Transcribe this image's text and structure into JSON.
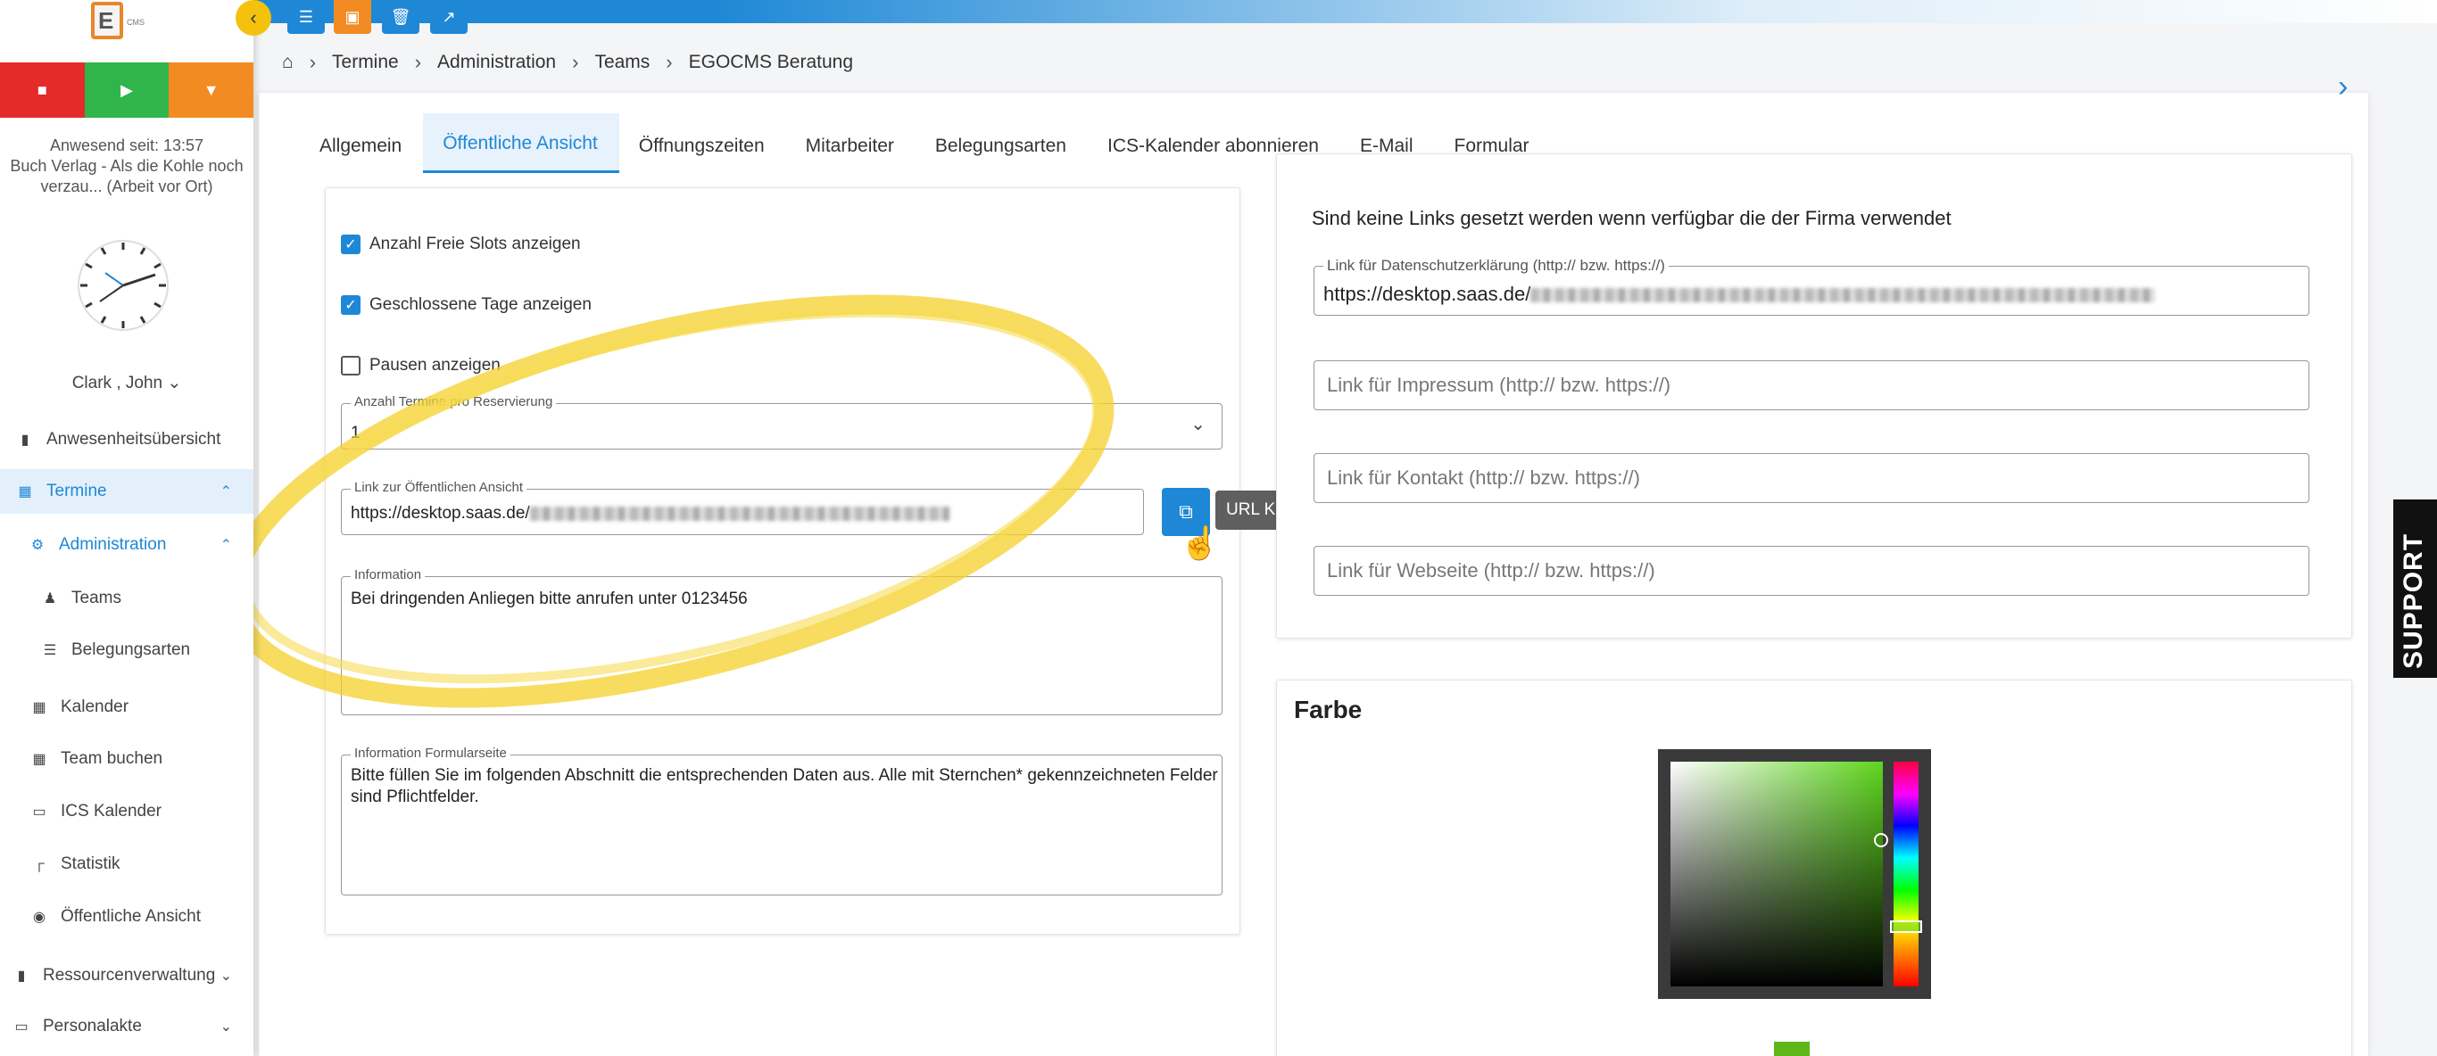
{
  "brand": {
    "logo_letter": "E",
    "logo_suffix": "CMS"
  },
  "toolbar": {
    "icons": [
      "list-icon",
      "save-icon",
      "trash-icon",
      "external-link-icon"
    ]
  },
  "sidebar": {
    "present_line1": "Anwesend seit: 13:57",
    "present_line2": "Buch Verlag - Als die Kohle noch",
    "present_line3": "verzau... (Arbeit vor Ort)",
    "user": "Clark , John",
    "items": [
      {
        "label": "Anwesenheitsübersicht"
      },
      {
        "label": "Termine"
      },
      {
        "label": "Administration"
      },
      {
        "label": "Teams"
      },
      {
        "label": "Belegungsarten"
      },
      {
        "label": "Kalender"
      },
      {
        "label": "Team buchen"
      },
      {
        "label": "ICS Kalender"
      },
      {
        "label": "Statistik"
      },
      {
        "label": "Öffentliche Ansicht"
      },
      {
        "label": "Ressourcenverwaltung"
      },
      {
        "label": "Personalakte"
      }
    ]
  },
  "breadcrumb": [
    "Termine",
    "Administration",
    "Teams",
    "EGOCMS Beratung"
  ],
  "tabs": [
    "Allgemein",
    "Öffentliche Ansicht",
    "Öffnungszeiten",
    "Mitarbeiter",
    "Belegungsarten",
    "ICS-Kalender abonnieren",
    "E-Mail",
    "Formular"
  ],
  "left_panel": {
    "cb_free_slots": "Anzahl Freie Slots anzeigen",
    "cb_closed_days": "Geschlossene Tage anzeigen",
    "cb_pauses": "Pausen anzeigen",
    "count_label": "Anzahl Termine pro Reservierung",
    "count_value": "1",
    "link_label": "Link zur Öffentlichen Ansicht",
    "link_value": "https://desktop.saas.de/",
    "info_label": "Information",
    "info_value": "Bei dringenden Anliegen bitte anrufen unter 0123456",
    "form_label": "Information Formularseite",
    "form_value_line1": "Bitte füllen Sie im folgenden Abschnitt die entsprechenden Daten aus. Alle mit Sternchen* gekennzeichneten Felder",
    "form_value_line2": "sind Pflichtfelder.",
    "tooltip": "URL Kopieren"
  },
  "right_panel": {
    "heading": "Sind keine Links gesetzt werden wenn verfügbar die der Firma verwendet",
    "privacy_label": "Link für Datenschutzerklärung (http:// bzw. https://)",
    "privacy_value": "https://desktop.saas.de/",
    "imprint_placeholder": "Link für Impressum (http:// bzw. https://)",
    "contact_placeholder": "Link für Kontakt (http:// bzw. https://)",
    "website_placeholder": "Link für Webseite (http:// bzw. https://)"
  },
  "color_panel": {
    "title": "Farbe",
    "selected_color": "#5fb51a"
  },
  "support": "SUPPORT",
  "colors": {
    "accent": "#1e88d6",
    "stop": "#e52a2a",
    "start": "#2fb54a",
    "pause": "#f28c22",
    "highlight": "#f4c20d"
  }
}
